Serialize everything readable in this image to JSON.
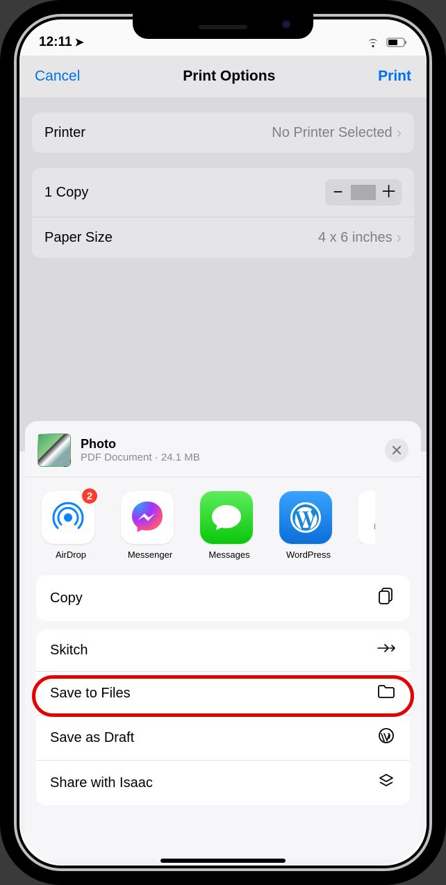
{
  "status": {
    "time": "12:11",
    "location_icon": "location-arrow-icon",
    "wifi_icon": "wifi-icon",
    "battery_icon": "battery-icon"
  },
  "print_options": {
    "nav": {
      "cancel": "Cancel",
      "title": "Print Options",
      "print": "Print"
    },
    "printer": {
      "label": "Printer",
      "value": "No Printer Selected"
    },
    "copies": {
      "label": "1 Copy"
    },
    "paper": {
      "label": "Paper Size",
      "value": "4 x 6 inches"
    }
  },
  "share_sheet": {
    "item": {
      "title": "Photo",
      "subtitle": "PDF Document · 24.1 MB"
    },
    "apps": [
      {
        "name": "AirDrop",
        "icon": "airdrop-icon",
        "badge": "2"
      },
      {
        "name": "Messenger",
        "icon": "messenger-icon",
        "badge": null
      },
      {
        "name": "Messages",
        "icon": "messages-icon",
        "badge": null
      },
      {
        "name": "WordPress",
        "icon": "wordpress-icon",
        "badge": null
      }
    ],
    "actions_group1": [
      {
        "label": "Copy",
        "icon": "copy-icon"
      }
    ],
    "actions_group2": [
      {
        "label": "Skitch",
        "icon": "skitch-icon"
      },
      {
        "label": "Save to Files",
        "icon": "folder-icon",
        "highlighted": true
      },
      {
        "label": "Save as Draft",
        "icon": "wordpress-icon"
      },
      {
        "label": "Share with Isaac",
        "icon": "layers-icon"
      }
    ]
  },
  "colors": {
    "accent": "#007aff",
    "highlight": "#e60000"
  }
}
